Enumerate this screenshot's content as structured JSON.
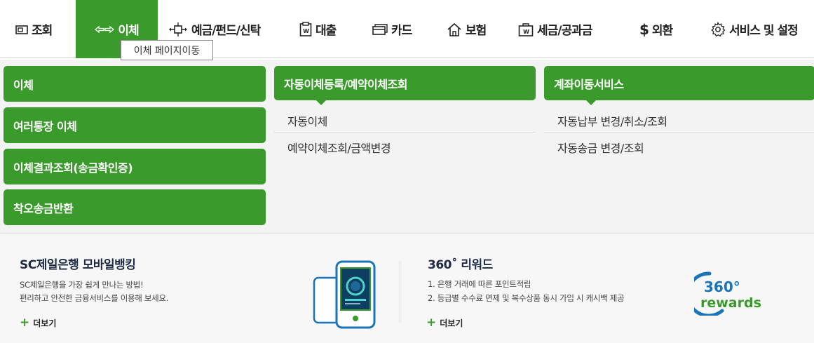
{
  "nav": {
    "items": [
      {
        "label": "조회"
      },
      {
        "label": "이체"
      },
      {
        "label": "예금/펀드/신탁"
      },
      {
        "label": "대출"
      },
      {
        "label": "카드"
      },
      {
        "label": "보험"
      },
      {
        "label": "세금/공과금"
      },
      {
        "label": "외환"
      },
      {
        "label": "서비스 및 설정"
      }
    ],
    "tooltip": "이체 페이지이동"
  },
  "menu": {
    "col1": [
      "이체",
      "여러통장 이체",
      "이체결과조회(송금확인증)",
      "착오송금반환"
    ],
    "col2": {
      "header": "자동이체등록/예약이체조회",
      "links": [
        "자동이체",
        "예약이체조회/금액변경"
      ]
    },
    "col3": {
      "header": "계좌이동서비스",
      "links": [
        "자동납부 변경/취소/조회",
        "자동송금 변경/조회"
      ]
    }
  },
  "promo": {
    "mobile": {
      "title": "SC제일은행 모바일뱅킹",
      "lines": [
        "SC제일은행을 가장 쉽게 만나는 방법!",
        "편리하고 안전한 금융서비스를 이용해 보세요."
      ],
      "more": "더보기"
    },
    "rewards": {
      "title": "360˚  리워드",
      "lines": [
        "1. 은행 거래에 따른 포인트적립",
        "2. 등급별 수수료 면제  및 복수상품 동시 가입 시 캐시백 제공"
      ],
      "more": "더보기",
      "logo_top": "360°",
      "logo_bottom": "rewards"
    }
  },
  "colors": {
    "accent": "#3a9b2c",
    "logo_blue": "#1a75b8",
    "logo_green": "#3a9b2c"
  }
}
